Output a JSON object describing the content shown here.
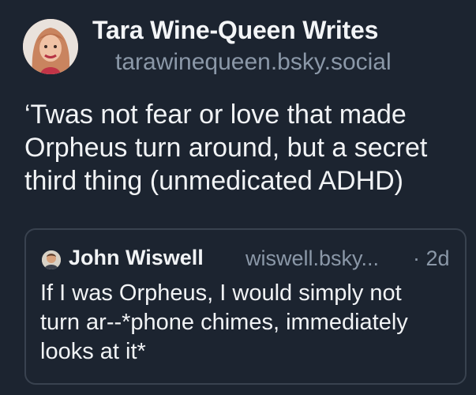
{
  "post": {
    "author": {
      "display_name": "Tara Wine-Queen Writes",
      "handle": "tarawinequeen.bsky.social",
      "avatar_icon": "profile-photo"
    },
    "text_lines": [
      "‘Twas not fear or love that made",
      "Orpheus turn around, but a secret",
      "third thing (unmedicated ADHD)"
    ]
  },
  "quote": {
    "author": {
      "display_name": "John Wiswell",
      "handle": "wiswell.bsky...",
      "avatar_icon": "profile-photo"
    },
    "timestamp": "· 2d",
    "text_lines": [
      "If I was Orpheus, I would simply not",
      "turn ar--*phone chimes, immediately",
      "looks at it*"
    ]
  },
  "colors": {
    "background": "#1c2430",
    "primary_text": "#f1f3f5",
    "secondary_text": "#8b98a8",
    "card_border": "#39424f"
  }
}
